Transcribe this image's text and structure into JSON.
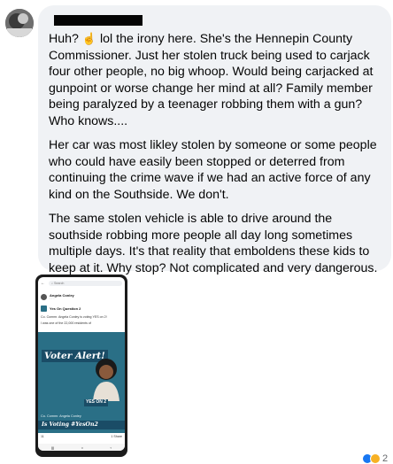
{
  "comment": {
    "author_name": "",
    "paragraphs": [
      "lol the irony here. She's the Hennepin County Commissioner. Just her stolen truck being used to carjack four other people, no big whoop. Would being carjacked at gunpoint or worse change her mind at all? Family member being paralyzed by a teenager robbing them with a gun? Who knows....",
      "Her car was most likley stolen by someone or some people who could have easily been stopped or deterred from continuing the crime wave if we had an active force of any kind on the Southside. We don't.",
      "The same stolen vehicle is able to drive around the southside robbing more people all day long sometimes multiple days. It's that reality that emboldens these kids to keep at it. Why stop? Not complicated and very dangerous."
    ],
    "first_prefix": "Huh?"
  },
  "screenshot": {
    "search_placeholder": "Search",
    "poster_name": "Angela Conley",
    "post_title": "Yes On Question 2",
    "caption": "Co. Commr. Angela Conley is voting YES on 2!",
    "quote": "I was one of the 22,000 residents of",
    "voter_alert": "Voter Alert!",
    "yes_badge": "YES ON 2",
    "candidate_line": "Co. Commr. Angela Conley",
    "voting_line": "Is Voting #YesOn2",
    "reaction_count": "11",
    "share_count": "1 Share"
  },
  "reactions": {
    "count": "2"
  }
}
